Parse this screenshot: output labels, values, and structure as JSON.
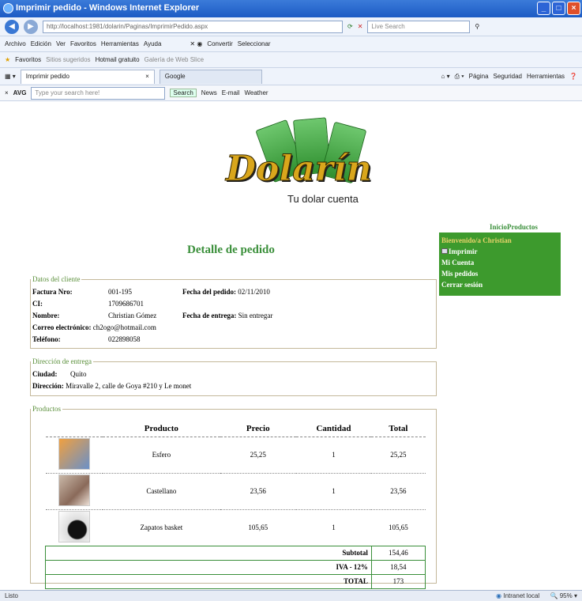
{
  "window": {
    "title": "Imprimir pedido - Windows Internet Explorer"
  },
  "address": {
    "url": "http://localhost:1981/dolarin/Paginas/ImprimirPedido.aspx",
    "search_placeholder": "Live Search"
  },
  "menu": [
    "Archivo",
    "Edición",
    "Ver",
    "Favoritos",
    "Herramientas",
    "Ayuda"
  ],
  "convert": {
    "convertir": "Convertir",
    "seleccionar": "Seleccionar"
  },
  "favorites": {
    "label": "Favoritos",
    "items": [
      "Sitios sugeridos",
      "Hotmail gratuito",
      "Galería de Web Slice"
    ]
  },
  "tabs": [
    {
      "label": "Imprimir pedido"
    },
    {
      "label": "Google"
    }
  ],
  "tools": [
    "Página",
    "Seguridad",
    "Herramientas"
  ],
  "avg": {
    "label": "AVG",
    "search_placeholder": "Type your search here!",
    "search_btn": "Search",
    "news": "News",
    "email": "E-mail",
    "weather": "Weather"
  },
  "status": {
    "left": "Listo",
    "zone": "Intranet local",
    "zoom": "95%"
  },
  "logo": {
    "brand": "Dolarín",
    "slogan": "Tu dolar cuenta"
  },
  "nav": {
    "inicio": "Inicio",
    "productos": "Productos"
  },
  "sidebar": {
    "welcome": "Bienvenido/a Christian",
    "items": [
      "Imprimir",
      "Mi Cuenta",
      "Mis pedidos",
      "Cerrar sesión"
    ]
  },
  "page": {
    "heading": "Detalle de pedido"
  },
  "cliente": {
    "legend": "Datos del cliente",
    "factura_label": "Factura Nro:",
    "factura": "001-195",
    "fecha_pedido_label": "Fecha del pedido:",
    "fecha_pedido": "02/11/2010",
    "ci_label": "CI:",
    "ci": "1709686701",
    "nombre_label": "Nombre:",
    "nombre": "Christian Gómez",
    "fecha_entrega_label": "Fecha de entrega:",
    "fecha_entrega": "Sin entregar",
    "correo_label": "Correo electrónico:",
    "correo": "ch2ogo@hotmail.com",
    "telefono_label": "Teléfono:",
    "telefono": "022898058"
  },
  "entrega": {
    "legend": "Dirección de entrega",
    "ciudad_label": "Ciudad:",
    "ciudad": "Quito",
    "direccion_label": "Dirección:",
    "direccion": "Miravalle 2, calle de Goya #210 y Le monet"
  },
  "productos": {
    "legend": "Productos",
    "headers": [
      "Producto",
      "Precio",
      "Cantidad",
      "Total"
    ],
    "rows": [
      {
        "name": "Esfero",
        "price": "25,25",
        "qty": "1",
        "total": "25,25"
      },
      {
        "name": "Castellano",
        "price": "23,56",
        "qty": "1",
        "total": "23,56"
      },
      {
        "name": "Zapatos basket",
        "price": "105,65",
        "qty": "1",
        "total": "105,65"
      }
    ],
    "subtotal_label": "Subtotal",
    "subtotal": "154,46",
    "iva_label": "IVA - 12%",
    "iva": "18,54",
    "total_label": "TOTAL",
    "total": "173"
  }
}
